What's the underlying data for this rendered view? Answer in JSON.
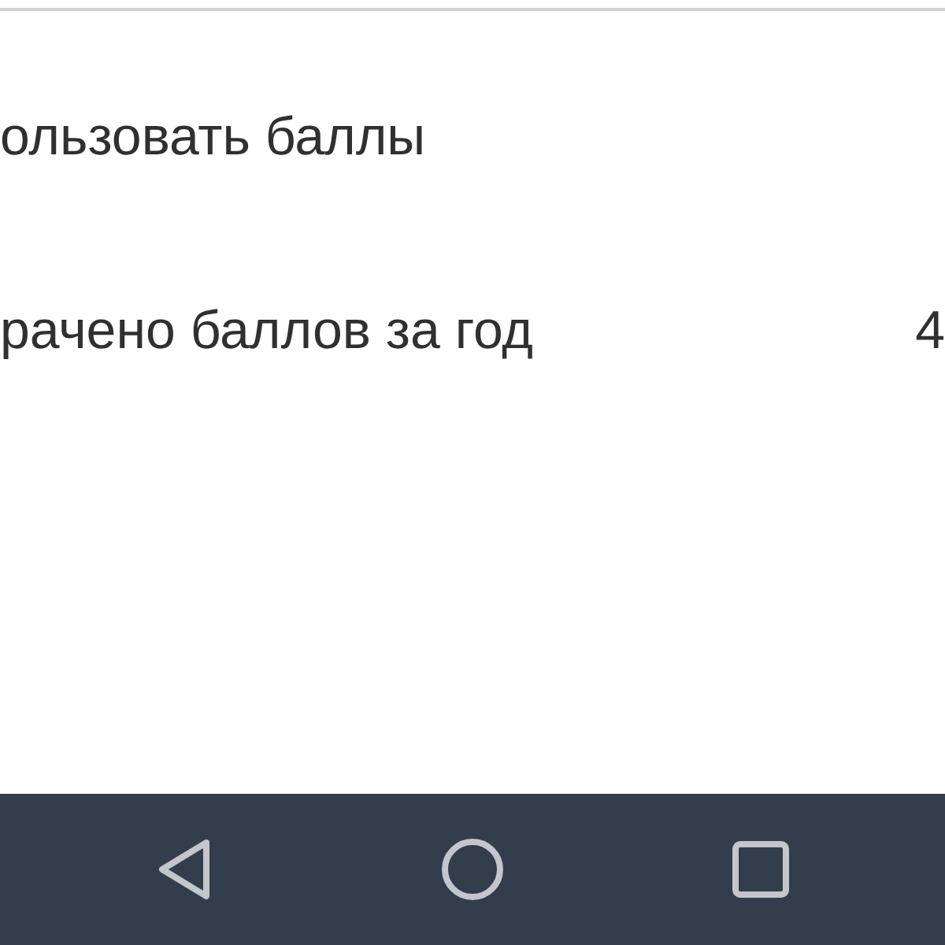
{
  "rows": [
    {
      "label": "ользовать баллы"
    },
    {
      "label": "рачено баллов за год",
      "value": "4"
    }
  ],
  "navigation_bar": {
    "buttons": [
      {
        "kind": "back"
      },
      {
        "kind": "home"
      },
      {
        "kind": "recent"
      }
    ]
  }
}
